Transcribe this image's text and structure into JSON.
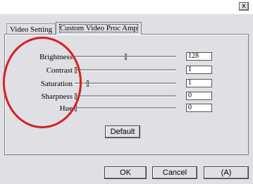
{
  "window": {
    "close_glyph": "x"
  },
  "tabs": [
    {
      "label": "Video Setting"
    },
    {
      "label": "Custom Video Proc Amp"
    }
  ],
  "settings": [
    {
      "label": "Brightness",
      "value": "128",
      "level": 0.5
    },
    {
      "label": "Contrast",
      "value": "1",
      "level": 0.0
    },
    {
      "label": "Saturation",
      "value": "1",
      "level": 0.12
    },
    {
      "label": "Sharpness",
      "value": "0",
      "level": 0.0
    },
    {
      "label": "Hue",
      "value": "0",
      "level": 0.0
    }
  ],
  "buttons": {
    "default_label": "Default",
    "ok_label": "OK",
    "cancel_label": "Cancel",
    "apply_label": "(A)"
  },
  "annotation": {
    "color": "#d42020"
  }
}
